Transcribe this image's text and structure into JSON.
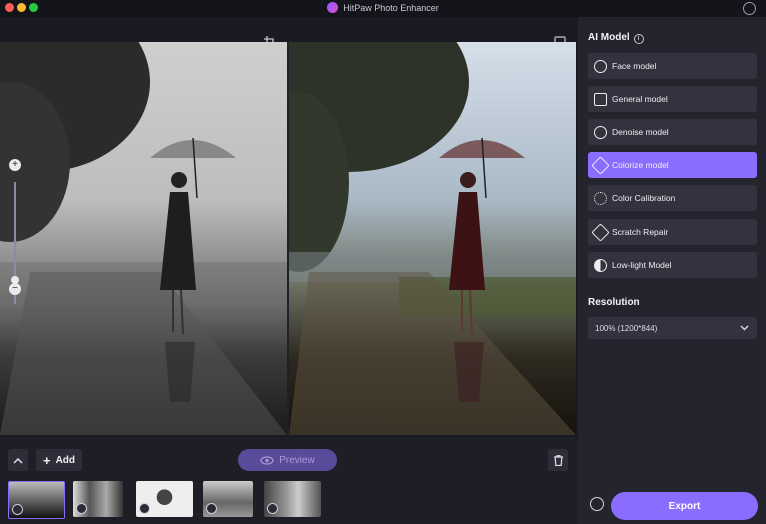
{
  "window": {
    "title": "HitPaw Photo Enhancer"
  },
  "toolbar": {
    "crop_icon": "crop-icon",
    "compare_icon": "compare-icon"
  },
  "zoom": {
    "plus": "+",
    "minus": "−"
  },
  "bottom": {
    "add_label": "Add",
    "preview_label": "Preview",
    "thumbnails": [
      {
        "badge_icon": "colorize-icon"
      },
      {
        "badge_icon": "colorize-icon"
      },
      {
        "badge_icon": "colorize-icon"
      },
      {
        "badge_icon": "colorize-icon"
      },
      {
        "badge_icon": "face-icon"
      }
    ]
  },
  "sidebar": {
    "ai_model_title": "AI Model",
    "models": [
      {
        "label": "Face model",
        "active": false
      },
      {
        "label": "General model",
        "active": false
      },
      {
        "label": "Denoise model",
        "active": false
      },
      {
        "label": "Colorize model",
        "active": true
      },
      {
        "label": "Color Calibration",
        "active": false
      },
      {
        "label": "Scratch Repair",
        "active": false
      },
      {
        "label": "Low-light Model",
        "active": false
      }
    ],
    "resolution_title": "Resolution",
    "resolution_value": "100% (1200*844)",
    "export_label": "Export"
  },
  "colors": {
    "accent": "#8a6cff",
    "panel": "#24242e",
    "button": "#33333f"
  }
}
